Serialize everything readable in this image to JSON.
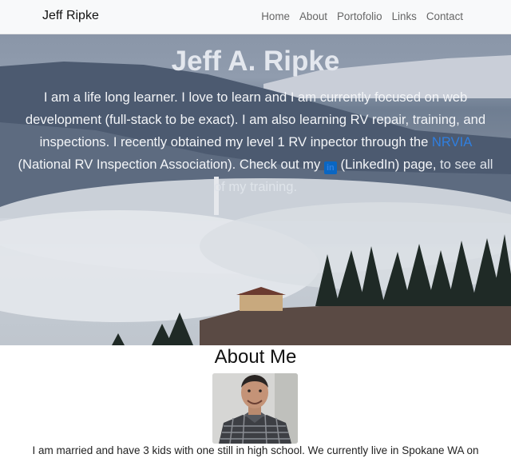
{
  "nav": {
    "brand": "Jeff Ripke",
    "links": [
      "Home",
      "About",
      "Portofolio",
      "Links",
      "Contact"
    ]
  },
  "hero": {
    "title": "Jeff A. Ripke",
    "text_1": "I am a life long learner. I love to learn and I am currently focused on web development (full-stack to be exact). I am also learning RV repair, training, and inspections. I recently obtained my level 1 RV inpector through the ",
    "nrvia_link": "NRVIA",
    "text_2": " (National RV Inspection Association). Check out my ",
    "linkedin_icon_glyph": "in",
    "text_3": " (LinkedIn) page, ",
    "text_4": "to see all of my training."
  },
  "about": {
    "title": "About Me",
    "text": "I am married and have 3 kids with one still in high school. We currently live in Spokane WA on"
  },
  "colors": {
    "nav_bg": "#f8f9fa",
    "link_blue": "#2f7fe0",
    "linkedin_blue": "#0a66c2"
  },
  "icons": {
    "linkedin": "linkedin-icon"
  }
}
